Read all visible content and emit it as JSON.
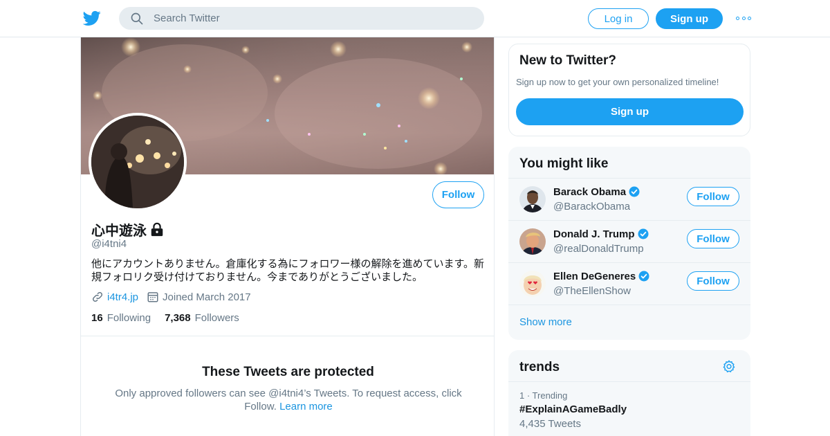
{
  "header": {
    "search_placeholder": "Search Twitter",
    "login_label": "Log in",
    "signup_label": "Sign up",
    "more_icon": "more-dots-icon",
    "logo_icon": "twitter-bird-icon"
  },
  "profile": {
    "display_name": "心中遊泳",
    "handle": "@i4tni4",
    "bio": "他にアカウントありません。倉庫化する為にフォロワー様の解除を進めています。新規フォロリク受け付けておりません。今までありがとうございました。",
    "website": "i4tr4.jp",
    "joined": "Joined March 2017",
    "following_count": "16",
    "following_label": "Following",
    "followers_count": "7,368",
    "followers_label": "Followers",
    "follow_label": "Follow",
    "protected_title": "These Tweets are protected",
    "protected_text": "Only approved followers can see @i4tni4’s Tweets. To request access, click Follow.",
    "learn_more": "Learn more"
  },
  "new_to_twitter": {
    "title": "New to Twitter?",
    "subtitle": "Sign up now to get your own personalized timeline!",
    "signup_label": "Sign up"
  },
  "you_might_like": {
    "title": "You might like",
    "show_more": "Show more",
    "accounts": [
      {
        "name": "Barack Obama",
        "handle": "@BarackObama",
        "follow": "Follow"
      },
      {
        "name": "Donald J. Trump",
        "handle": "@realDonaldTrump",
        "follow": "Follow"
      },
      {
        "name": "Ellen DeGeneres",
        "handle": "@TheEllenShow",
        "follow": "Follow"
      }
    ]
  },
  "trends": {
    "title": "trends",
    "items": [
      {
        "meta": "1 · Trending",
        "name": "#ExplainAGameBadly",
        "count": "4,435 Tweets"
      }
    ]
  },
  "colors": {
    "accent": "#1da1f2",
    "link": "#1b95e0",
    "secondary_text": "#657786",
    "panel_bg": "#f5f8fa"
  }
}
